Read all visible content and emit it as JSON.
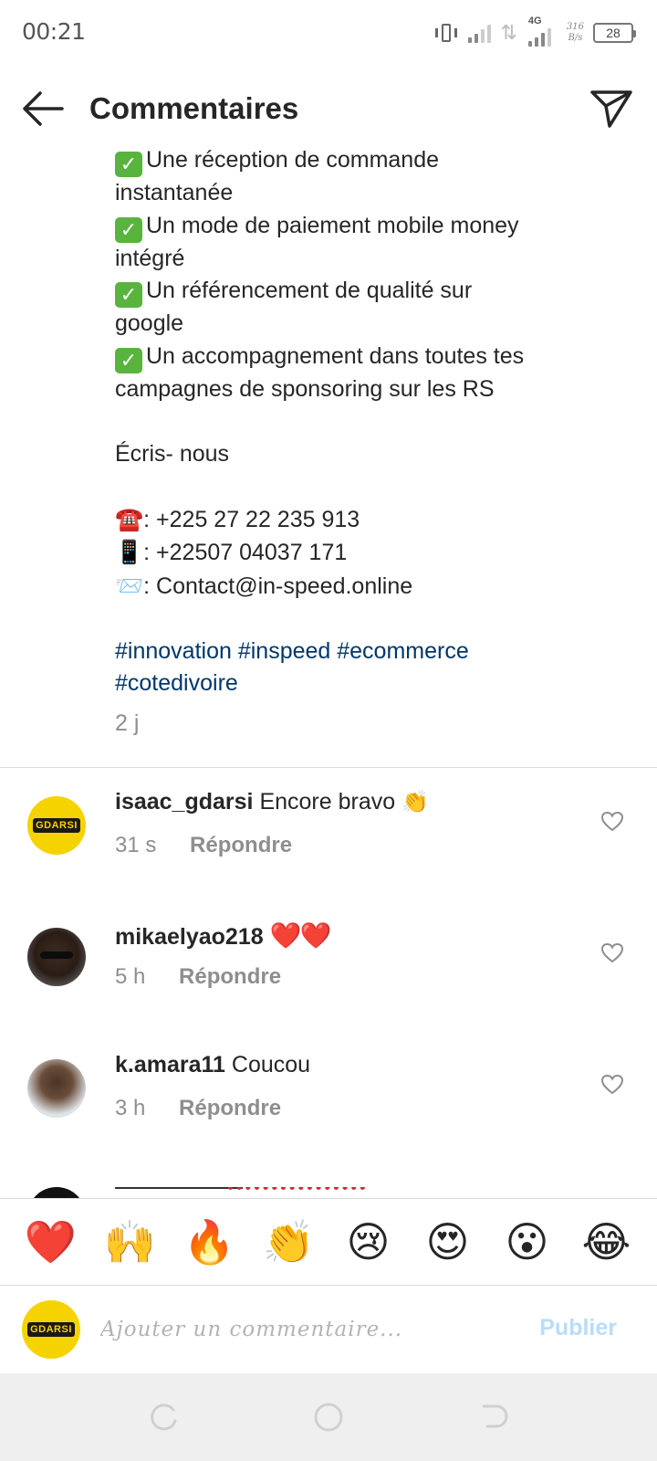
{
  "status_bar": {
    "time": "00:21",
    "network_type": "4G",
    "speed_value": "316",
    "speed_unit": "B/s",
    "battery_level": "28"
  },
  "header": {
    "title": "Commentaires",
    "back_icon": "arrow-left-icon",
    "send_icon": "paper-plane-icon"
  },
  "caption": {
    "lines": [
      {
        "check": true,
        "text": "Une réception de commande"
      },
      {
        "check": false,
        "text": "instantanée"
      },
      {
        "check": true,
        "text": "Un mode de paiement mobile money"
      },
      {
        "check": false,
        "text": "intégré"
      },
      {
        "check": true,
        "text": "Un référencement de qualité sur"
      },
      {
        "check": false,
        "text": "google"
      },
      {
        "check": true,
        "text": "Un accompagnement dans toutes tes"
      },
      {
        "check": false,
        "text": "campagnes de sponsoring sur les RS"
      },
      {
        "check": false,
        "text": ""
      },
      {
        "check": false,
        "text": "Écris- nous"
      },
      {
        "check": false,
        "text": ""
      }
    ],
    "contacts": [
      {
        "emoji": "☎️",
        "text": ": +225 27 22 235 913"
      },
      {
        "emoji": "📱",
        "text": ": +22507 04037 171"
      },
      {
        "emoji": "📨",
        "text": ": Contact@in-speed.online"
      }
    ],
    "hashtags_line1": "#innovation #inspeed #ecommerce",
    "hashtags_line2": "#cotedivoire",
    "time": "2 j"
  },
  "comments": [
    {
      "username": "isaac_gdarsi",
      "text": "Encore bravo",
      "emoji": "👏",
      "time": "31 s",
      "reply": "Répondre",
      "avatar_text": "GDARSI"
    },
    {
      "username": "mikaelyao218",
      "text": "",
      "emoji": "❤️❤️",
      "time": "5 h",
      "reply": "Répondre"
    },
    {
      "username": "k.amara11",
      "text": "Coucou",
      "emoji": "",
      "time": "3 h",
      "reply": "Répondre"
    }
  ],
  "emoji_bar": [
    "❤️",
    "🙌",
    "🔥",
    "👏",
    "😢",
    "😍",
    "😮",
    "😂"
  ],
  "composer": {
    "avatar_text": "GDARSI",
    "placeholder": "Ajouter un commentaire...",
    "publish_label": "Publier"
  },
  "colors": {
    "hashtag": "#00376b",
    "secondary_text": "#8e8e8e",
    "publish_disabled": "#b9dcfa",
    "check_green": "#59b33f"
  }
}
